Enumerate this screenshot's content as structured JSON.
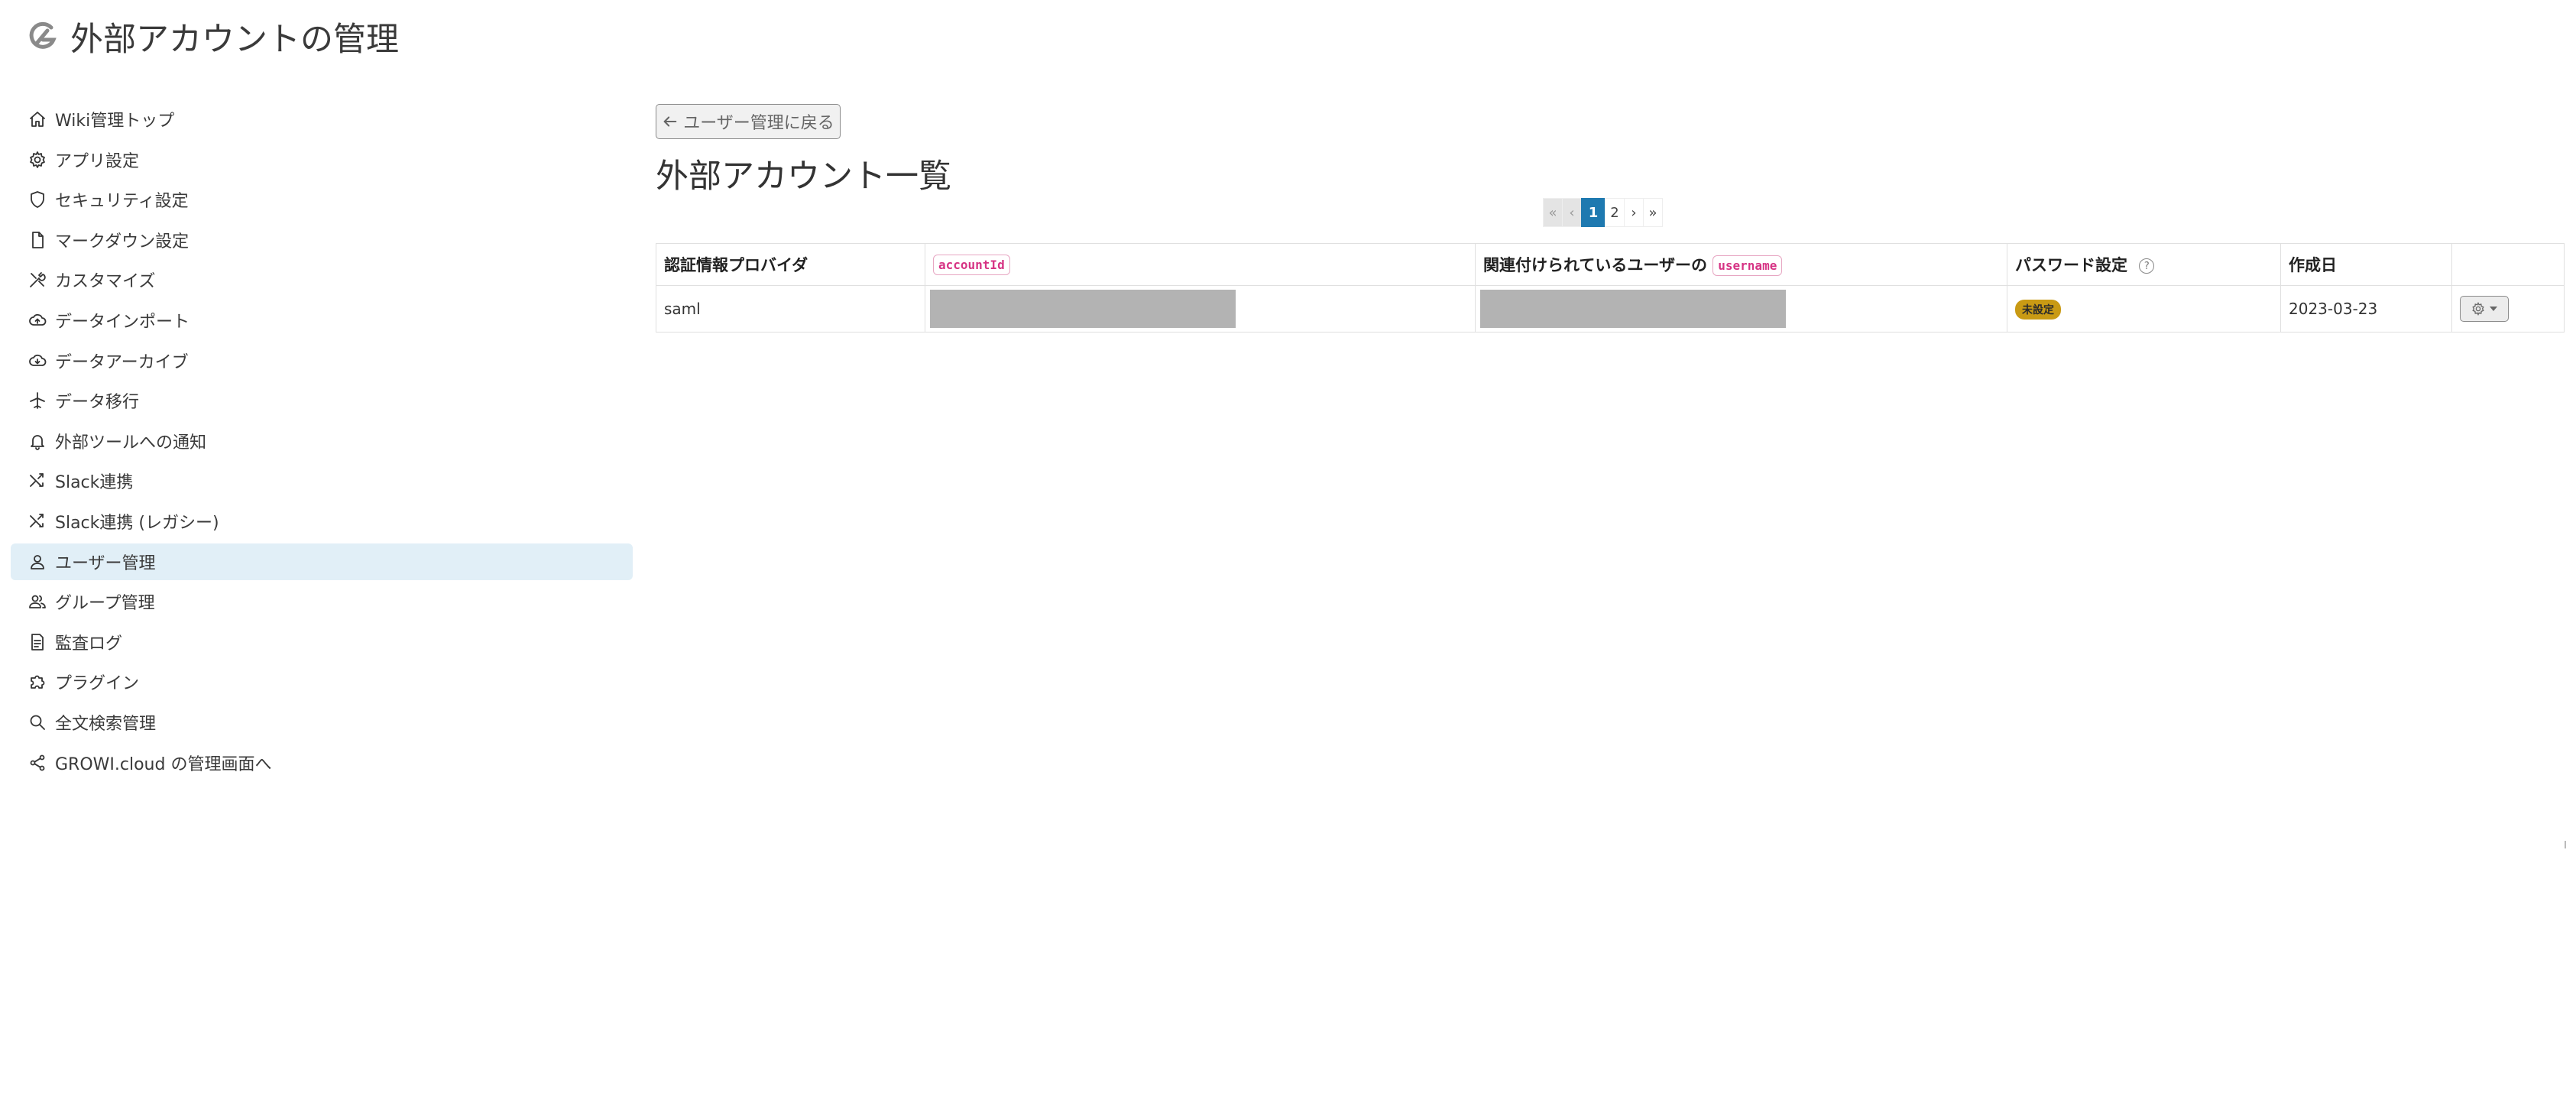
{
  "header": {
    "title": "外部アカウントの管理",
    "logo_icon": "growi-logo-icon"
  },
  "sidebar": {
    "items": [
      {
        "label": "Wiki管理トップ",
        "icon": "home-icon"
      },
      {
        "label": "アプリ設定",
        "icon": "gear-icon"
      },
      {
        "label": "セキュリティ設定",
        "icon": "shield-icon"
      },
      {
        "label": "マークダウン設定",
        "icon": "file-icon"
      },
      {
        "label": "カスタマイズ",
        "icon": "tools-icon"
      },
      {
        "label": "データインポート",
        "icon": "cloud-upload-icon"
      },
      {
        "label": "データアーカイブ",
        "icon": "cloud-download-icon"
      },
      {
        "label": "データ移行",
        "icon": "airplane-icon"
      },
      {
        "label": "外部ツールへの通知",
        "icon": "bell-icon"
      },
      {
        "label": "Slack連携",
        "icon": "shuffle-icon"
      },
      {
        "label": "Slack連携 (レガシー)",
        "icon": "shuffle-icon"
      },
      {
        "label": "ユーザー管理",
        "icon": "user-icon",
        "active": true
      },
      {
        "label": "グループ管理",
        "icon": "users-icon"
      },
      {
        "label": "監査ログ",
        "icon": "log-icon"
      },
      {
        "label": "プラグイン",
        "icon": "puzzle-icon"
      },
      {
        "label": "全文検索管理",
        "icon": "search-icon"
      },
      {
        "label": "GROWI.cloud の管理画面へ",
        "icon": "share-icon"
      }
    ]
  },
  "main": {
    "back_button_label": "ユーザー管理に戻る",
    "section_title": "外部アカウント一覧",
    "pagination": {
      "first": "«",
      "prev": "‹",
      "pages": [
        "1",
        "2"
      ],
      "current": "1",
      "next": "›",
      "last": "»"
    },
    "table": {
      "columns": {
        "provider": "認証情報プロバイダ",
        "account_id_code": "accountId",
        "linked_user_prefix": "関連付けられているユーザーの",
        "username_code": "username",
        "password": "パスワード設定",
        "created": "作成日"
      },
      "rows": [
        {
          "provider": "saml",
          "password_status": "未設定",
          "created": "2023-03-23"
        }
      ]
    }
  },
  "colors": {
    "active_bg": "#e1eff7",
    "primary": "#1e79b0",
    "code_pink": "#d63384",
    "warning_badge": "#c99a14"
  }
}
